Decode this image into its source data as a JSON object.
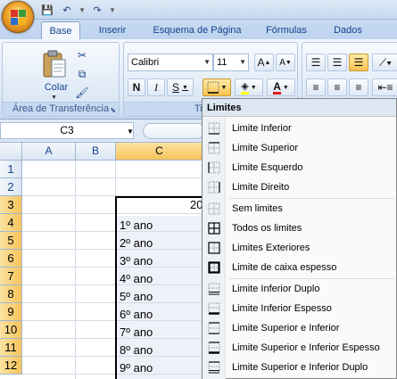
{
  "qat": {
    "save": "💾",
    "undo": "↶",
    "redo": "↷"
  },
  "tabs": [
    "Base",
    "Inserir",
    "Esquema de Página",
    "Fórmulas",
    "Dados"
  ],
  "clipboard": {
    "paste_label": "Colar",
    "group_label": "Área de Transferência"
  },
  "font": {
    "name": "Calibri",
    "size": "11",
    "group_label": "Tipo de"
  },
  "formula_bar": {
    "cell_ref": "C3"
  },
  "grid": {
    "columns": [
      "A",
      "B",
      "C"
    ],
    "rows": [
      "1",
      "2",
      "3",
      "4",
      "5",
      "6",
      "7",
      "8",
      "9",
      "10",
      "11",
      "12"
    ],
    "c3_partial": "20",
    "c_values": [
      "1º ano",
      "2º ano",
      "3º ano",
      "4º ano",
      "5º ano",
      "6º ano",
      "7º ano",
      "8º ano",
      "9º ano"
    ]
  },
  "borders_menu": {
    "title": "Limites",
    "items": [
      {
        "label": "Limite Inferior",
        "icon": "border-bottom-icon"
      },
      {
        "label": "Limite Superior",
        "icon": "border-top-icon"
      },
      {
        "label": "Limite Esquerdo",
        "icon": "border-left-icon"
      },
      {
        "label": "Limite Direito",
        "icon": "border-right-icon"
      },
      {
        "label": "Sem limites",
        "icon": "no-border-icon"
      },
      {
        "label": "Todos os limites",
        "icon": "all-borders-icon"
      },
      {
        "label": "Limites Exteriores",
        "icon": "outside-borders-icon"
      },
      {
        "label": "Limite de caixa espesso",
        "icon": "thick-box-border-icon"
      },
      {
        "label": "Limite Inferior Duplo",
        "icon": "bottom-double-border-icon"
      },
      {
        "label": "Limite Inferior Espesso",
        "icon": "thick-bottom-border-icon"
      },
      {
        "label": "Limite Superior e Inferior",
        "icon": "top-bottom-border-icon"
      },
      {
        "label": "Limite Superior e Inferior Espesso",
        "icon": "top-thick-bottom-border-icon"
      },
      {
        "label": "Limite Superior e Inferior Duplo",
        "icon": "top-double-bottom-border-icon"
      }
    ]
  }
}
